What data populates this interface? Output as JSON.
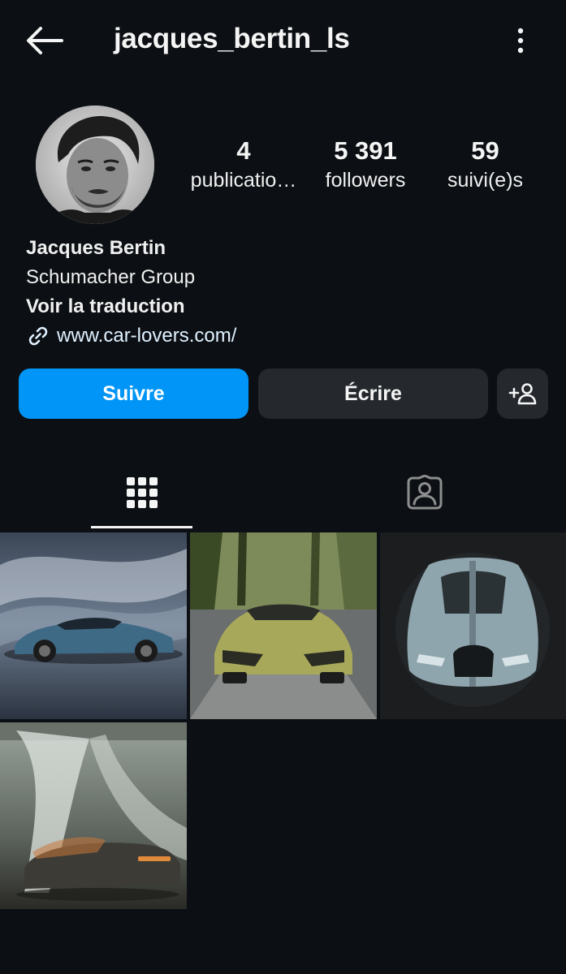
{
  "header": {
    "username": "jacques_bertin_ls",
    "back_icon": "arrow-left-icon",
    "more_icon": "more-vertical-icon"
  },
  "profile": {
    "avatar_icon": "avatar",
    "stats": [
      {
        "value": "4",
        "label": "publicatio…"
      },
      {
        "value": "5 391",
        "label": "followers"
      },
      {
        "value": "59",
        "label": "suivi(e)s"
      }
    ],
    "name": "Jacques Bertin",
    "category": "Schumacher Group",
    "translate": "Voir la traduction",
    "link": "www.car-lovers.com/"
  },
  "actions": {
    "follow": "Suivre",
    "message": "Écrire",
    "add_user_icon": "add-user-icon"
  },
  "tabs": {
    "grid_icon": "grid-icon",
    "tagged_icon": "tagged-icon"
  },
  "posts": [
    {
      "icon": "car-photo"
    },
    {
      "icon": "car-photo"
    },
    {
      "icon": "car-photo"
    },
    {
      "icon": "car-photo"
    }
  ],
  "colors": {
    "background": "#0c1014",
    "accent": "#0095f6",
    "button_secondary": "#25292e",
    "text": "#f5f5f5"
  }
}
